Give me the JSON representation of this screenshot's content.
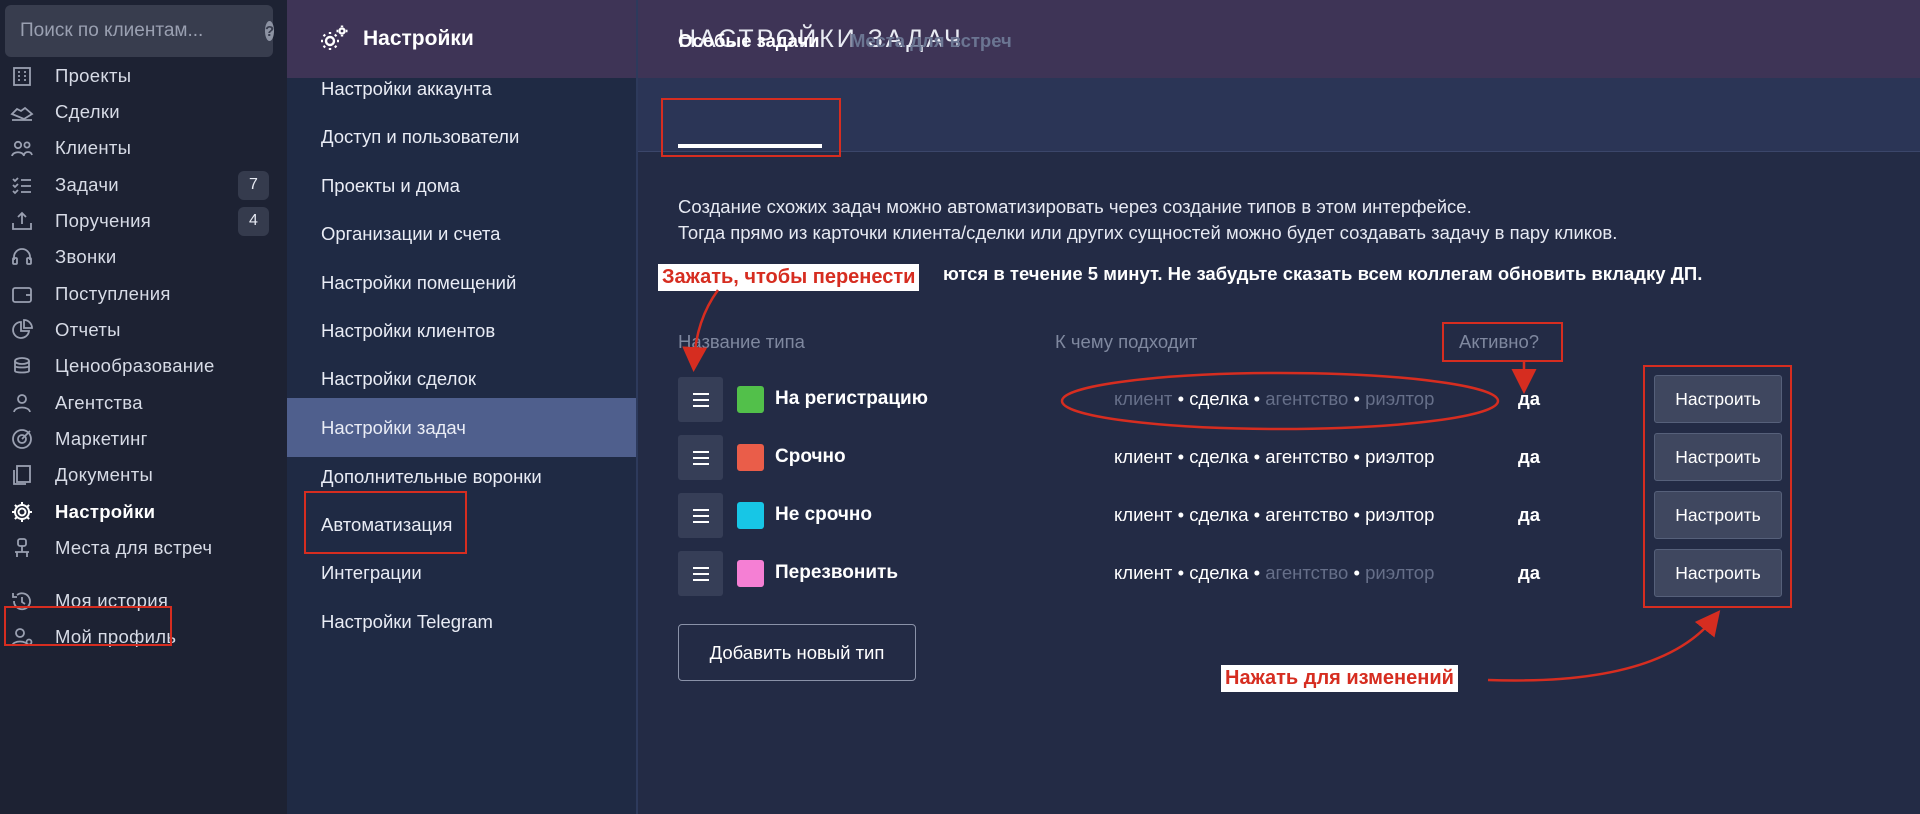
{
  "search": {
    "placeholder": "Поиск по клиентам..."
  },
  "sidebar": {
    "items": [
      {
        "label": "Проекты",
        "icon": "building-icon"
      },
      {
        "label": "Сделки",
        "icon": "handshake-icon"
      },
      {
        "label": "Клиенты",
        "icon": "users-icon"
      },
      {
        "label": "Задачи",
        "icon": "tasks-icon",
        "badge": "7"
      },
      {
        "label": "Поручения",
        "icon": "inbox-upload-icon",
        "badge": "4"
      },
      {
        "label": "Звонки",
        "icon": "headset-icon"
      },
      {
        "label": "Поступления",
        "icon": "wallet-icon"
      },
      {
        "label": "Отчеты",
        "icon": "pie-chart-icon"
      },
      {
        "label": "Ценообразование",
        "icon": "coins-icon"
      },
      {
        "label": "Агентства",
        "icon": "agent-icon"
      },
      {
        "label": "Маркетинг",
        "icon": "target-icon"
      },
      {
        "label": "Документы",
        "icon": "documents-icon"
      },
      {
        "label": "Настройки",
        "icon": "gear-icon"
      },
      {
        "label": "Места для встреч",
        "icon": "meeting-place-icon"
      },
      {
        "label": "Моя история",
        "icon": "history-icon"
      },
      {
        "label": "Мой профиль",
        "icon": "profile-icon"
      }
    ]
  },
  "settings": {
    "title": "Настройки",
    "items": [
      "Настройки аккаунта",
      "Доступ и пользователи",
      "Проекты и дома",
      "Организации и счета",
      "Настройки помещений",
      "Настройки клиентов",
      "Настройки сделок",
      "Настройки задач",
      "Дополнительные воронки",
      "Автоматизация",
      "Интеграции",
      "Настройки Telegram"
    ]
  },
  "main": {
    "title": "НАСТРОЙКИ ЗАДАЧ",
    "tabs": [
      "Особые задачи",
      "Места для встреч"
    ],
    "desc1": "Создание схожих задач можно автоматизировать через создание типов в этом интерфейсе.",
    "desc2": "Тогда прямо из карточки клиента/сделки или других сущностей можно будет создавать задачу в пару кликов.",
    "desc3": "ются в течение 5 минут. Не забудьте сказать всем коллегам обновить вкладку ДП.",
    "columns": {
      "name": "Название типа",
      "applies": "К чему подходит",
      "active": "Активно?"
    },
    "applies_words": [
      "клиент",
      "сделка",
      "агентство",
      "риэлтор"
    ],
    "separator": "•",
    "rows": [
      {
        "name": "На регистрацию",
        "color": "#52c04a",
        "applies": [
          false,
          true,
          false,
          false
        ],
        "active": "да",
        "button": "Настроить"
      },
      {
        "name": "Срочно",
        "color": "#ea5d49",
        "applies": [
          true,
          true,
          true,
          true
        ],
        "active": "да",
        "button": "Настроить"
      },
      {
        "name": "Не срочно",
        "color": "#17c6e6",
        "applies": [
          true,
          true,
          true,
          true
        ],
        "active": "да",
        "button": "Настроить"
      },
      {
        "name": "Перезвонить",
        "color": "#f57fd4",
        "applies": [
          true,
          true,
          false,
          false
        ],
        "active": "да",
        "button": "Настроить"
      }
    ],
    "add_button": "Добавить новый тип"
  },
  "annotations": {
    "drag_hint": "Зажать, чтобы перенести",
    "click_hint": "Нажать для изменений",
    "color": "#d62d20"
  },
  "colors": {
    "sidebar_bg": "#1d2233",
    "header_purple": "#3e3456",
    "settings_bg": "#1f2a44",
    "main_bg": "#232b45",
    "active_item": "#4f5f8d"
  }
}
